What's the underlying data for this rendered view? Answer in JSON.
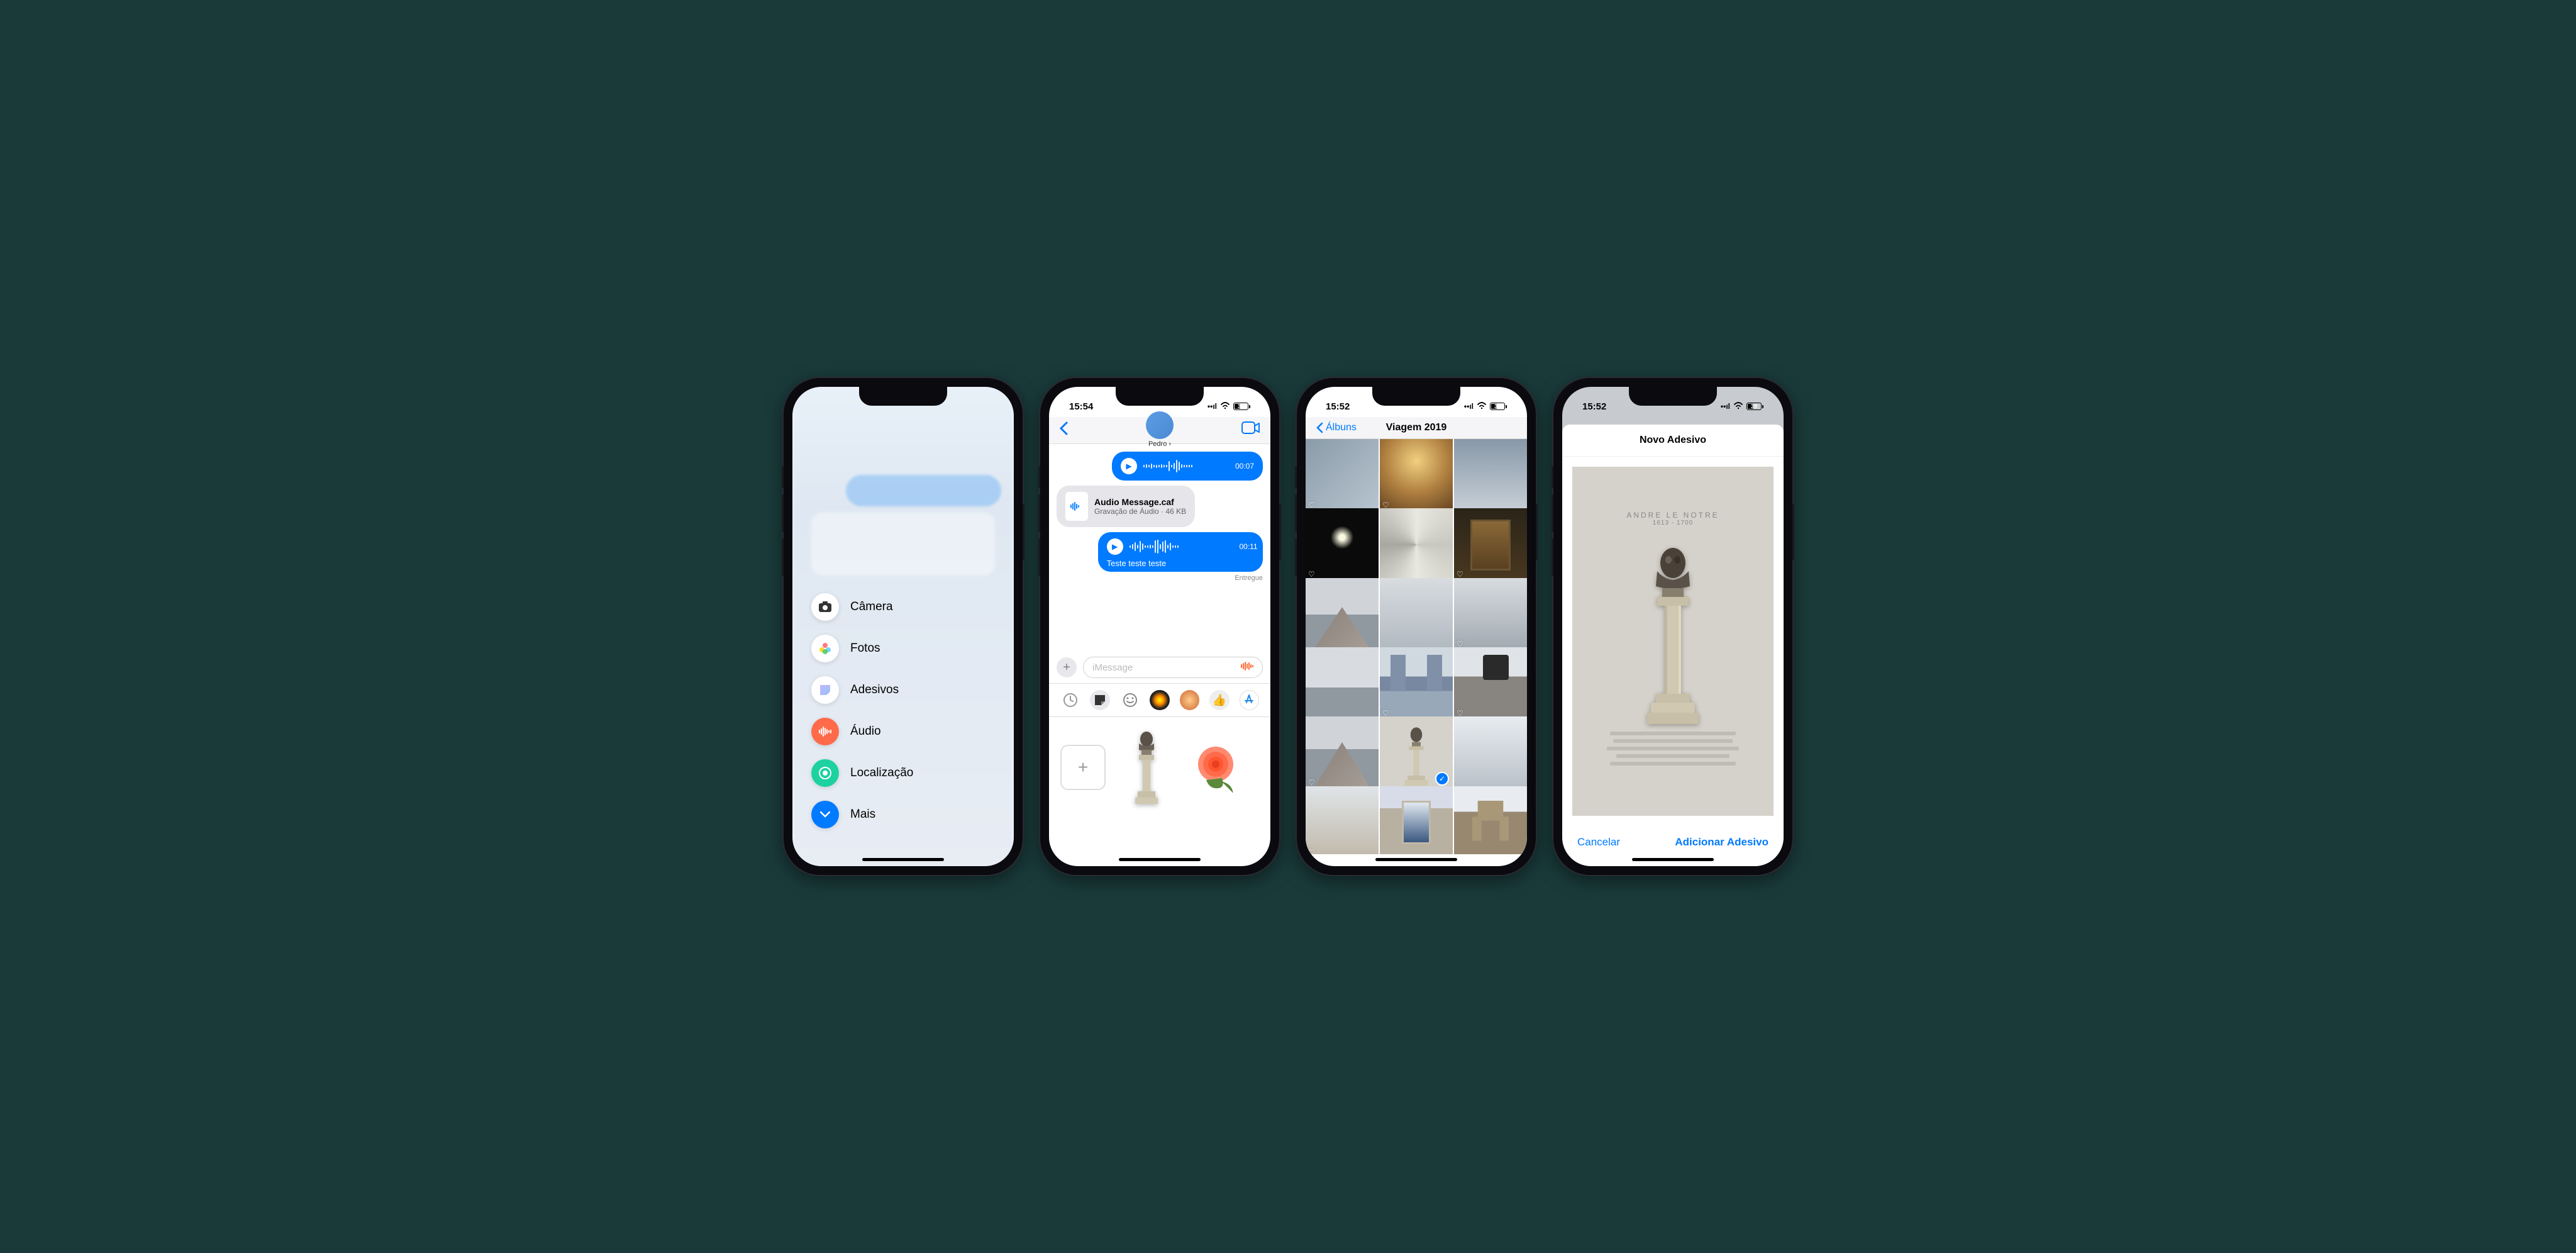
{
  "phone1": {
    "menu": {
      "camera": "Câmera",
      "photos": "Fotos",
      "stickers": "Adesivos",
      "audio": "Áudio",
      "location": "Localização",
      "more": "Mais"
    }
  },
  "phone2": {
    "status_time": "15:54",
    "battery": "39",
    "contact_name": "Pedro",
    "audio1_duration": "00:07",
    "file_name": "Audio Message.caf",
    "file_meta": "Gravação de Áudio · 46 KB",
    "audio2_duration": "00:11",
    "text_msg": "Teste teste teste",
    "delivery_status": "Entregue",
    "input_placeholder": "iMessage"
  },
  "phone3": {
    "status_time": "15:52",
    "battery": "39",
    "back_label": "Álbuns",
    "title": "Viagem 2019"
  },
  "phone4": {
    "status_time": "15:52",
    "battery": "39",
    "title": "Novo Adesivo",
    "plaque_name": "ANDRE  LE NOTRE",
    "plaque_years": "1613 - 1700",
    "cancel": "Cancelar",
    "add": "Adicionar Adesivo"
  }
}
